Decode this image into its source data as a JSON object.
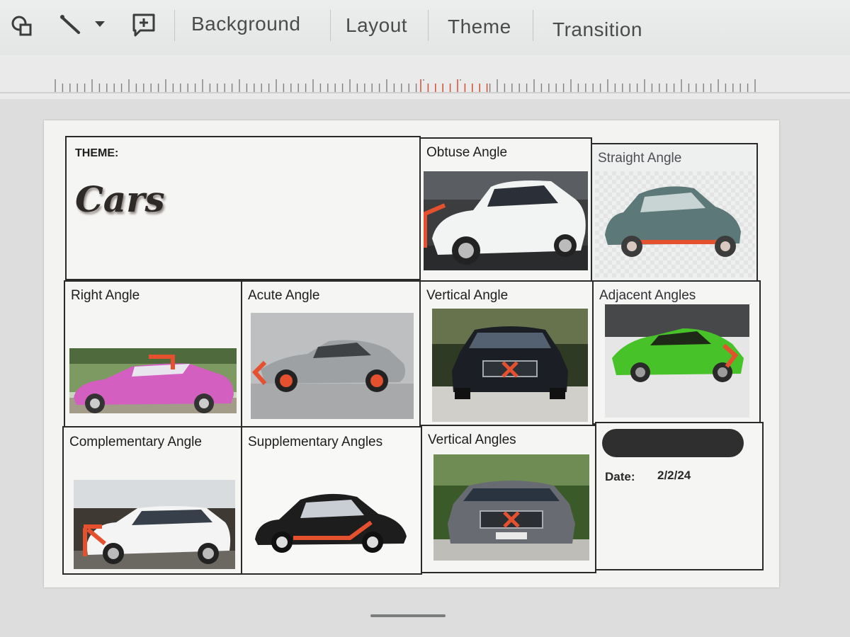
{
  "toolbar": {
    "shapes_icon": "shapes-icon",
    "line_icon": "line-icon",
    "comment_icon": "add-comment-icon",
    "buttons": [
      "Background",
      "Layout",
      "Theme",
      "Transition"
    ]
  },
  "slide": {
    "theme_label": "THEME:",
    "theme_value": "Cars",
    "cells": {
      "obtuse": "Obtuse Angle",
      "straight": "Straight Angle",
      "right": "Right Angle",
      "acute": "Acute Angle",
      "vertical1": "Vertical Angle",
      "adjacent": "Adjacent Angles",
      "complementary": "Complementary Angle",
      "supplementary": "Supplementary Angles",
      "vertical2": "Vertical Angles"
    },
    "date_label": "Date:",
    "date_value": "2/2/24"
  },
  "colors": {
    "angle_marker": "#e5502f",
    "pink_car": "#d35fc0",
    "green_car": "#48c229"
  }
}
